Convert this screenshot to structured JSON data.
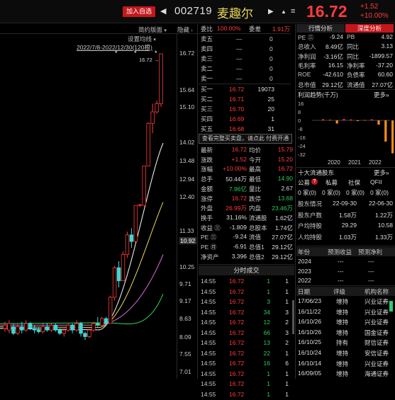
{
  "header": {
    "add_watchlist": "加入自选",
    "prev_arrow": "◀",
    "code": "002719",
    "name": "麦趣尔",
    "next_arrow": "▶",
    "bell": "▲",
    "menu": "≡",
    "price": "16.72",
    "change": "+1.52",
    "change_pct": "+10.00%"
  },
  "chart_panel": {
    "toolbar_left": "简约版面",
    "toolbar_right": "隐藏",
    "setting": "设置均线",
    "range": "2022/7/8-2022/12/30(120根)",
    "marker": "16.72",
    "y_ticks": [
      "16.72",
      "15.64",
      "15.10",
      "14.02",
      "13.48",
      "12.94",
      "12.40",
      "11.33",
      "10.92",
      "10.25",
      "9.71",
      "9.17",
      "8.63",
      "8.09",
      "7.55",
      "7.01"
    ],
    "candles": [
      {
        "o": 8.35,
        "c": 8.45,
        "h": 8.55,
        "l": 8.25
      },
      {
        "o": 8.3,
        "c": 8.5,
        "h": 8.6,
        "l": 8.2
      },
      {
        "o": 8.4,
        "c": 8.2,
        "h": 8.5,
        "l": 8.15
      },
      {
        "o": 8.2,
        "c": 8.4,
        "h": 8.5,
        "l": 8.15
      },
      {
        "o": 8.4,
        "c": 8.3,
        "h": 8.55,
        "l": 8.2
      },
      {
        "o": 8.3,
        "c": 8.5,
        "h": 8.6,
        "l": 8.25
      },
      {
        "o": 8.5,
        "c": 8.35,
        "h": 8.55,
        "l": 8.3
      },
      {
        "o": 8.35,
        "c": 8.3,
        "h": 8.45,
        "l": 8.2
      },
      {
        "o": 8.3,
        "c": 8.25,
        "h": 8.4,
        "l": 8.2
      },
      {
        "o": 8.25,
        "c": 8.4,
        "h": 8.5,
        "l": 8.2
      },
      {
        "o": 8.4,
        "c": 8.3,
        "h": 8.5,
        "l": 8.25
      },
      {
        "o": 8.3,
        "c": 8.45,
        "h": 8.5,
        "l": 8.25
      },
      {
        "o": 8.45,
        "c": 8.3,
        "h": 8.5,
        "l": 8.25
      },
      {
        "o": 8.3,
        "c": 8.2,
        "h": 8.35,
        "l": 8.15
      },
      {
        "o": 8.2,
        "c": 8.3,
        "h": 8.35,
        "l": 8.1
      },
      {
        "o": 8.3,
        "c": 8.45,
        "h": 8.5,
        "l": 8.25
      },
      {
        "o": 8.45,
        "c": 8.3,
        "h": 8.5,
        "l": 8.2
      },
      {
        "o": 8.3,
        "c": 8.5,
        "h": 8.6,
        "l": 8.25
      },
      {
        "o": 8.5,
        "c": 8.2,
        "h": 8.55,
        "l": 8.1
      },
      {
        "o": 8.2,
        "c": 8.1,
        "h": 8.25,
        "l": 8.0
      },
      {
        "o": 8.1,
        "c": 8.3,
        "h": 8.35,
        "l": 8.05
      },
      {
        "o": 8.3,
        "c": 8.5,
        "h": 8.55,
        "l": 8.25
      },
      {
        "o": 8.5,
        "c": 8.45,
        "h": 8.7,
        "l": 8.4
      },
      {
        "o": 8.45,
        "c": 8.65,
        "h": 8.7,
        "l": 8.4
      },
      {
        "o": 8.65,
        "c": 8.5,
        "h": 8.7,
        "l": 8.45
      },
      {
        "o": 8.5,
        "c": 9.3,
        "h": 9.35,
        "l": 8.5
      },
      {
        "o": 9.3,
        "c": 10.2,
        "h": 10.25,
        "l": 9.2
      },
      {
        "o": 10.2,
        "c": 9.8,
        "h": 10.4,
        "l": 9.6
      },
      {
        "o": 9.8,
        "c": 10.6,
        "h": 10.7,
        "l": 9.8
      },
      {
        "o": 10.6,
        "c": 11.2,
        "h": 11.3,
        "l": 10.5
      },
      {
        "o": 11.2,
        "c": 11.0,
        "h": 11.4,
        "l": 10.8
      },
      {
        "o": 11.0,
        "c": 12.1,
        "h": 12.1,
        "l": 11.0
      },
      {
        "o": 12.1,
        "c": 12.12,
        "h": 12.15,
        "l": 12.05
      },
      {
        "o": 12.1,
        "c": 13.3,
        "h": 13.3,
        "l": 12.1
      },
      {
        "o": 13.3,
        "c": 14.6,
        "h": 14.63,
        "l": 13.3
      },
      {
        "o": 14.6,
        "c": 14.95,
        "h": 15.2,
        "l": 14.3
      },
      {
        "o": 14.95,
        "c": 15.2,
        "h": 15.3,
        "l": 14.9
      },
      {
        "o": 15.2,
        "c": 16.72,
        "h": 16.72,
        "l": 15.1
      }
    ]
  },
  "orderbook": {
    "ratio_label": "委比",
    "ratio_val": "100.00%",
    "diff_label": "委差",
    "diff_val": "1.91万",
    "asks": [
      {
        "label": "卖五",
        "price": "—",
        "vol": "0"
      },
      {
        "label": "卖四",
        "price": "—",
        "vol": "0"
      },
      {
        "label": "卖三",
        "price": "—",
        "vol": "0"
      },
      {
        "label": "卖二",
        "price": "—",
        "vol": "0"
      },
      {
        "label": "卖一",
        "price": "—",
        "vol": "0"
      }
    ],
    "bids": [
      {
        "label": "买一",
        "price": "16.72",
        "vol": "19073"
      },
      {
        "label": "买二",
        "price": "16.71",
        "vol": "25"
      },
      {
        "label": "买三",
        "price": "16.70",
        "vol": "20"
      },
      {
        "label": "买四",
        "price": "16.69",
        "vol": "1"
      },
      {
        "label": "买五",
        "price": "16.68",
        "vol": "31"
      }
    ],
    "banner": "查看完整买卖盘，请点此 付费开通"
  },
  "stats": [
    [
      "最新",
      "16.72",
      "均价",
      "15.79"
    ],
    [
      "涨跌",
      "+1.52",
      "今开",
      "15.20"
    ],
    [
      "涨幅",
      "+10.00%",
      "最高",
      "16.72"
    ],
    [
      "总手",
      "50.44万",
      "最低",
      "14.90"
    ],
    [
      "金额",
      "7.96亿",
      "量比",
      "2.67"
    ],
    [
      "涨停",
      "16.72",
      "跌停",
      "13.68"
    ],
    [
      "外盘",
      "26.99万",
      "内盘",
      "23.46万"
    ],
    [
      "换手",
      "31.16%",
      "流通股",
      "1.62亿"
    ],
    [
      "收益 ㊂",
      "-1.809",
      "总股本",
      "1.74亿"
    ],
    [
      "PE ㊂",
      "-9.24",
      "流值",
      "27.07亿"
    ],
    [
      "PE ㊊",
      "-6.91",
      "总值1",
      "29.12亿"
    ],
    [
      "净资产",
      "3.396",
      "总值2",
      "29.12亿"
    ]
  ],
  "trades_title": "分时成交",
  "trades": [
    {
      "t": "14:55",
      "p": "16.72",
      "v": "1",
      "n": "1"
    },
    {
      "t": "14:55",
      "p": "16.72",
      "v": "1",
      "n": "1"
    },
    {
      "t": "14:55",
      "p": "16.72",
      "v": "3",
      "n": "1"
    },
    {
      "t": "14:55",
      "p": "16.72",
      "v": "34",
      "n": "3"
    },
    {
      "t": "14:55",
      "p": "16.72",
      "v": "12",
      "n": "2"
    },
    {
      "t": "14:55",
      "p": "16.72",
      "v": "66",
      "n": "3"
    },
    {
      "t": "14:55",
      "p": "16.72",
      "v": "13",
      "n": "2"
    },
    {
      "t": "14:55",
      "p": "16.72",
      "v": "22",
      "n": "1"
    },
    {
      "t": "14:55",
      "p": "16.72",
      "v": "16",
      "n": "6"
    },
    {
      "t": "14:55",
      "p": "16.72",
      "v": "1",
      "n": "1"
    },
    {
      "t": "14:55",
      "p": "16.72",
      "v": "1",
      "n": "1"
    },
    {
      "t": "14:55",
      "p": "16.72",
      "v": "1",
      "n": "1"
    }
  ],
  "right_panel": {
    "tab1": "行情分析",
    "tab2": "深度分析",
    "fund": [
      [
        "PE ㊂",
        "-9.24",
        "PB",
        "4.92"
      ],
      [
        "总收入",
        "8.49亿",
        "同比",
        "3.13"
      ],
      [
        "净利润",
        "-3.16亿",
        "同比",
        "-1899.57"
      ],
      [
        "毛利率",
        "16.15",
        "净利率",
        "-37.20"
      ],
      [
        "ROE",
        "-42.610",
        "负债率",
        "60.60"
      ],
      [
        "总市值",
        "29.12亿",
        "流通值",
        "27.07亿"
      ]
    ],
    "profit_title": "利润趋势(千万)",
    "more": "更多»",
    "profit_yticks": [
      "16",
      "8",
      "0",
      "-8",
      "-16",
      "-24",
      "-32"
    ],
    "profit_years": [
      "2020",
      "2021",
      "2022"
    ],
    "holders_title": "十大流通股东",
    "holder_types": [
      "公募",
      "私募",
      "社保",
      "QFII"
    ],
    "holder_counts": [
      "0 家(0)",
      "0 家(0)",
      "0 家(0)",
      "0 家(0)"
    ],
    "holder_rows": [
      [
        "股东情况",
        "22-09-30",
        "22-06-30"
      ],
      [
        "股东户数",
        "1.58万",
        "1.22万"
      ],
      [
        "户均持股",
        "29.29",
        "10.58"
      ],
      [
        "人均持股",
        "1.03万",
        "1.33万"
      ]
    ],
    "forecast_head": [
      "年份",
      "预测收益",
      "预测净利"
    ],
    "forecast_rows": [
      [
        "2024",
        "---",
        "---"
      ],
      [
        "2023",
        "---",
        "---"
      ],
      [
        "2022",
        "---",
        "---"
      ]
    ],
    "rating_head": [
      "日期",
      "评级",
      "机构名称"
    ],
    "ratings": [
      [
        "17/06/23",
        "增持",
        "兴业证券"
      ],
      [
        "16/11/22",
        "增持",
        "兴业证券"
      ],
      [
        "16/10/26",
        "增持",
        "兴业证券"
      ],
      [
        "16/10/26",
        "增持",
        "国金证券"
      ],
      [
        "16/10/25",
        "持有",
        "财信证券"
      ],
      [
        "16/10/24",
        "增持",
        "安信证券"
      ],
      [
        "16/10/14",
        "增持",
        "兴业证券"
      ],
      [
        "16/09/05",
        "增持",
        "海通证券"
      ]
    ]
  },
  "chart_data": {
    "type": "bar",
    "title": "利润趋势(千万)",
    "categories": [
      "2020",
      "2021",
      "2022"
    ],
    "series": [
      {
        "name": "利润",
        "values": [
          1.0,
          0.6,
          -3.0,
          1.2,
          0.8,
          -0.5,
          0.4,
          0.9,
          -4.0,
          -20.0,
          -31.0
        ]
      }
    ],
    "ylim": [
      -32,
      16
    ]
  }
}
